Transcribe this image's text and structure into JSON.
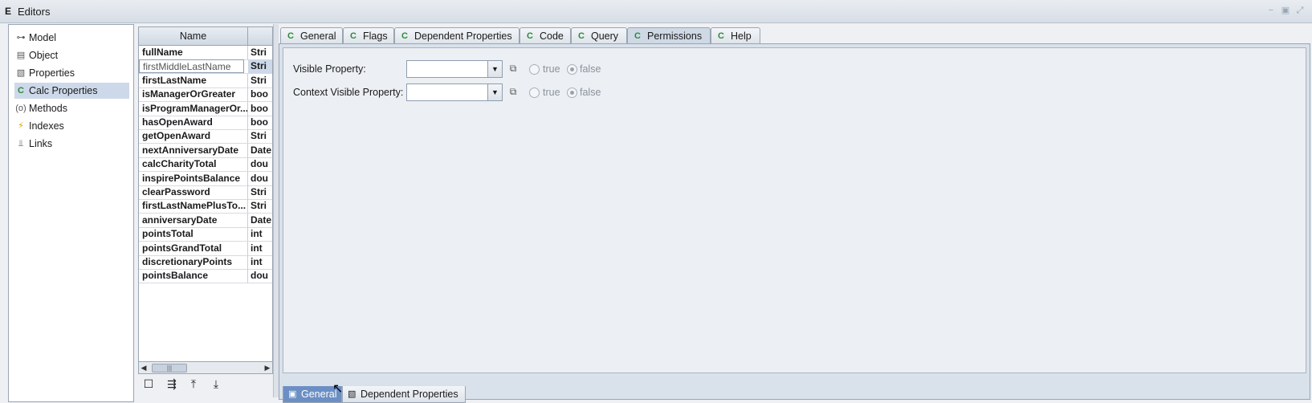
{
  "window": {
    "title": "Editors",
    "app_glyph": "E",
    "controls": [
      "minimize-icon",
      "restore-icon",
      "maximize-icon"
    ]
  },
  "nav": {
    "items": [
      {
        "label": "Model",
        "icon": "model-icon",
        "selected": false
      },
      {
        "label": "Object",
        "icon": "object-icon",
        "selected": false
      },
      {
        "label": "Properties",
        "icon": "properties-icon",
        "selected": false
      },
      {
        "label": "Calc Properties",
        "icon": "calc-properties-icon",
        "selected": true
      },
      {
        "label": "Methods",
        "icon": "methods-icon",
        "selected": false
      },
      {
        "label": "Indexes",
        "icon": "indexes-icon",
        "selected": false
      },
      {
        "label": "Links",
        "icon": "links-icon",
        "selected": false
      }
    ]
  },
  "table": {
    "columns": [
      "Name",
      ""
    ],
    "rows": [
      {
        "name": "fullName",
        "type": "Stri"
      },
      {
        "name": "firstMiddleLastName",
        "type": "Stri"
      },
      {
        "name": "firstLastName",
        "type": "Stri"
      },
      {
        "name": "isManagerOrGreater",
        "type": "boo"
      },
      {
        "name": "isProgramManagerOr...",
        "type": "boo"
      },
      {
        "name": "hasOpenAward",
        "type": "boo"
      },
      {
        "name": "getOpenAward",
        "type": "Stri"
      },
      {
        "name": "nextAnniversaryDate",
        "type": "Date"
      },
      {
        "name": "calcCharityTotal",
        "type": "dou"
      },
      {
        "name": "inspirePointsBalance",
        "type": "dou"
      },
      {
        "name": "clearPassword",
        "type": "Stri"
      },
      {
        "name": "firstLastNamePlusTo...",
        "type": "Stri"
      },
      {
        "name": "anniversaryDate",
        "type": "Date"
      },
      {
        "name": "pointsTotal",
        "type": "int"
      },
      {
        "name": "pointsGrandTotal",
        "type": "int"
      },
      {
        "name": "discretionaryPoints",
        "type": "int"
      },
      {
        "name": "pointsBalance",
        "type": "dou"
      }
    ],
    "scroll_thumb": "|||",
    "toolbar": [
      "new-icon",
      "add-child-icon",
      "move-up-icon",
      "move-down-icon"
    ]
  },
  "tabs": {
    "top": [
      "General",
      "Flags",
      "Dependent Properties",
      "Code",
      "Query",
      "Permissions",
      "Help"
    ],
    "active_top": "Permissions",
    "bottom": [
      "General",
      "Dependent Properties"
    ],
    "active_bottom": "General"
  },
  "permissions": {
    "visible_property_label": "Visible Property:",
    "context_visible_property_label": "Context Visible Property:",
    "visible_value": "",
    "context_visible_value": "",
    "true_label": "true",
    "false_label": "false",
    "visible_selected": "false",
    "context_selected": "false"
  },
  "colors": {
    "accent": "#6b8fc4",
    "selection": "#cdd9ea",
    "tab_icon_green": "#2d8a3a"
  }
}
